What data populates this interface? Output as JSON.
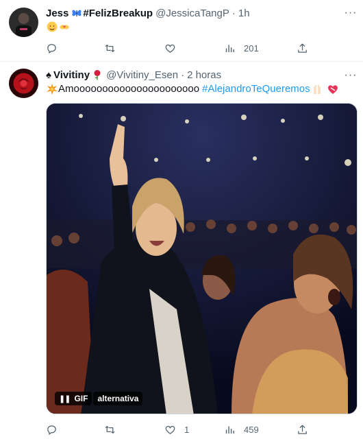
{
  "tweets": [
    {
      "display_name": "Jess",
      "name_suffix": "#FelizBreakup",
      "handle": "@JessicaTangP",
      "dot": "·",
      "time": "1h",
      "text": "",
      "emoji_icons": [
        "smiling-face-with-hearts-icon",
        "hands-heart-icon"
      ],
      "actions": {
        "reply": "",
        "retweet": "",
        "like": "",
        "views": "201"
      }
    },
    {
      "display_name": "Vivitiny",
      "handle": "@Vivitiny_Esen",
      "dot": "·",
      "time": "2 horas",
      "text": "Amoooooooooooooooooooooo",
      "hashtag": "#AlejandroTeQueremos",
      "media": {
        "badge": "GIF",
        "alt": "alternativa"
      },
      "actions": {
        "reply": "",
        "retweet": "",
        "like": "1",
        "views": "459"
      }
    }
  ],
  "colors": {
    "accent": "#1d9bf0",
    "muted": "#536471",
    "text": "#0f1419",
    "border": "#eff3f4"
  }
}
